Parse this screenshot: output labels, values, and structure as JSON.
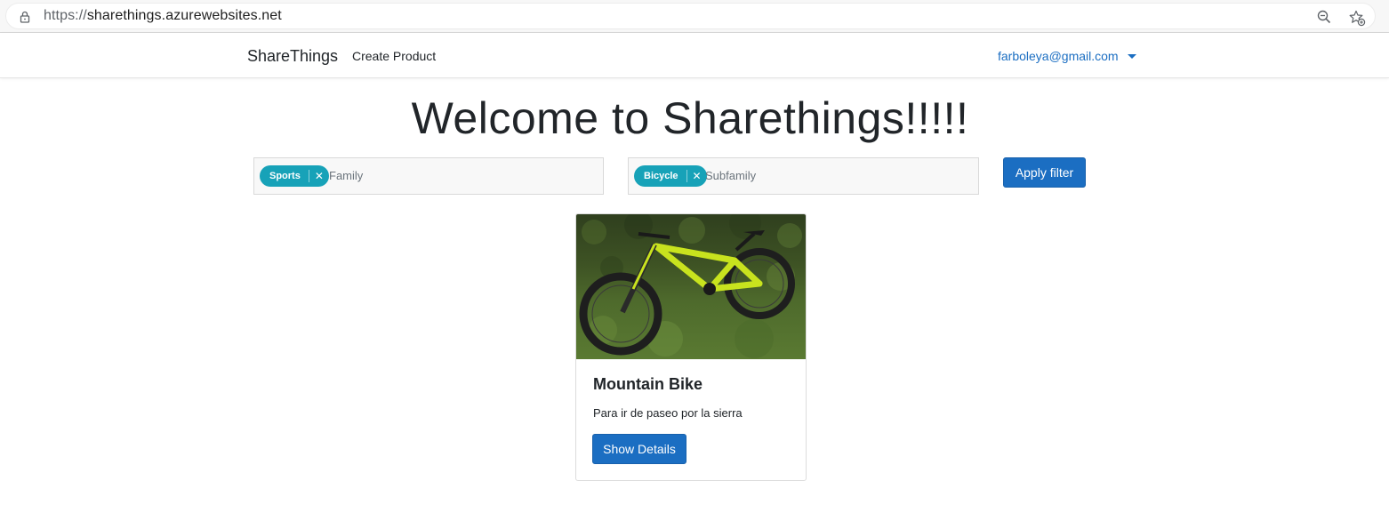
{
  "browser": {
    "url_protocol": "https://",
    "url_host": "sharethings.azurewebsites.net"
  },
  "navbar": {
    "brand": "ShareThings",
    "links": [
      {
        "label": "Create Product"
      }
    ],
    "user_email": "farboleya@gmail.com"
  },
  "main": {
    "title": "Welcome to Sharethings!!!!!",
    "filters": {
      "family": {
        "tag": "Sports",
        "placeholder": "Family"
      },
      "subfamily": {
        "tag": "Bicycle",
        "placeholder": "Subfamily"
      },
      "apply_label": "Apply filter"
    },
    "products": [
      {
        "title": "Mountain Bike",
        "description": "Para ir de paseo por la sierra",
        "button_label": "Show Details"
      }
    ]
  },
  "colors": {
    "primary": "#1b6ec2",
    "tag": "#17a2b8",
    "bike_frame": "#c8e31e"
  }
}
